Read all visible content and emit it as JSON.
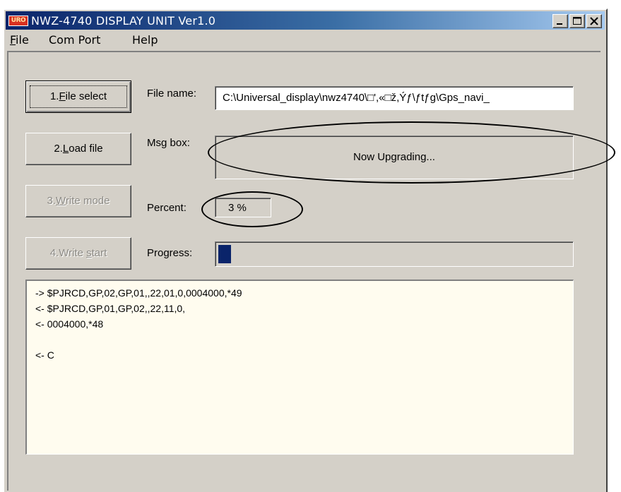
{
  "window": {
    "title": "NWZ-4740 DISPLAY UNIT Ver1.0",
    "icon_label": "URO"
  },
  "menu": {
    "items": [
      {
        "label": "File",
        "mnemonic": "F",
        "rest": "ile"
      },
      {
        "label": "Com Port"
      },
      {
        "label": "Help"
      }
    ]
  },
  "buttons": {
    "file_select": {
      "label": "1.File select",
      "prefix": "1.",
      "mnemonic": "F",
      "rest": "ile select"
    },
    "load_file": {
      "label": "2.Load file",
      "prefix": "2.",
      "mnemonic": "L",
      "rest": "oad file"
    },
    "write_mode": {
      "label": "3.Write mode",
      "prefix": "3.",
      "mnemonic": "W",
      "rest": "rite mode"
    },
    "write_start": {
      "label": "4.Write start",
      "prefix": "4.Write ",
      "mnemonic": "s",
      "rest": "tart"
    }
  },
  "fields": {
    "file_name_label": "File name:",
    "file_name_value": "C:\\Universal_display\\nwz4740\\□',«□ž,Ýƒ\\ƒtƒg\\Gps_navi_",
    "msg_box_label": "Msg box:",
    "msg_box_value": "Now Upgrading...",
    "percent_label": "Percent:",
    "percent_value": "3 %",
    "progress_label": "Progress:",
    "progress_fraction": 0.03
  },
  "log": {
    "lines": [
      "-> $PJRCD,GP,02,GP,01,,22,01,0,0004000,*49",
      "<- $PJRCD,GP,01,GP,02,,22,11,0,",
      "<- 0004000,*48",
      "",
      "<- C"
    ]
  },
  "colors": {
    "face": "#d4d0c8",
    "title_start": "#0a246a",
    "progress_fill": "#0a246a",
    "log_bg": "#fffcef"
  }
}
